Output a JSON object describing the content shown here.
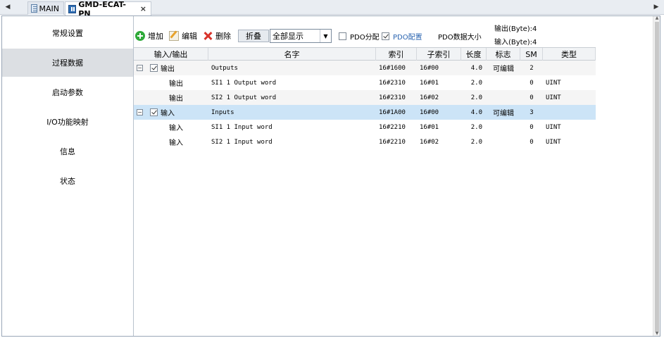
{
  "tabs": [
    {
      "label": "MAIN",
      "icon": "program-icon"
    },
    {
      "label": "GMD-ECAT-PN",
      "icon": "device-icon",
      "active": true
    }
  ],
  "nav_arrows": {
    "left": "◀",
    "right": "▶"
  },
  "close_glyph": "×",
  "sidebar": {
    "items": [
      {
        "label": "常规设置"
      },
      {
        "label": "过程数据",
        "selected": true
      },
      {
        "label": "启动参数"
      },
      {
        "label": "I/O功能映射"
      },
      {
        "label": "信息"
      },
      {
        "label": "状态"
      }
    ]
  },
  "toolbar": {
    "add_label": "增加",
    "edit_label": "编辑",
    "delete_label": "删除",
    "fold_label": "折叠",
    "filter_value": "全部显示",
    "pdo_assign_label": "PDO分配",
    "pdo_assign_checked": false,
    "pdo_config_label": "PDO配置",
    "pdo_config_checked": true,
    "pdo_size_label": "PDO数据大小",
    "output_size": "输出(Byte):4",
    "input_size": "输入(Byte):4"
  },
  "table": {
    "columns": [
      "输入/输出",
      "名字",
      "索引",
      "子索引",
      "长度",
      "标志",
      "SM",
      "类型"
    ],
    "rows": [
      {
        "io": "输出",
        "name": "Outputs",
        "index": "16#1600",
        "subindex": "16#00",
        "length": "4.0",
        "flag": "可编辑",
        "sm": "2",
        "type": "",
        "level": 0,
        "checked": true
      },
      {
        "io": "输出",
        "name": "SI1 1 Output word",
        "index": "16#2310",
        "subindex": "16#01",
        "length": "2.0",
        "flag": "",
        "sm": "0",
        "type": "UINT",
        "level": 1
      },
      {
        "io": "输出",
        "name": "SI2 1 Output word",
        "index": "16#2310",
        "subindex": "16#02",
        "length": "2.0",
        "flag": "",
        "sm": "0",
        "type": "UINT",
        "level": 1
      },
      {
        "io": "输入",
        "name": "Inputs",
        "index": "16#1A00",
        "subindex": "16#00",
        "length": "4.0",
        "flag": "可编辑",
        "sm": "3",
        "type": "",
        "level": 0,
        "checked": true,
        "selected": true
      },
      {
        "io": "输入",
        "name": "SI1 1 Input word",
        "index": "16#2210",
        "subindex": "16#01",
        "length": "2.0",
        "flag": "",
        "sm": "0",
        "type": "UINT",
        "level": 1
      },
      {
        "io": "输入",
        "name": "SI2 1 Input word",
        "index": "16#2210",
        "subindex": "16#02",
        "length": "2.0",
        "flag": "",
        "sm": "0",
        "type": "UINT",
        "level": 1
      }
    ]
  },
  "colors": {
    "selected_row": "#cce4f7",
    "nav_selected": "#dcdfe3",
    "add_icon": "#2faa3a",
    "delete_icon": "#d8332b",
    "link_text": "#2a64b0"
  }
}
